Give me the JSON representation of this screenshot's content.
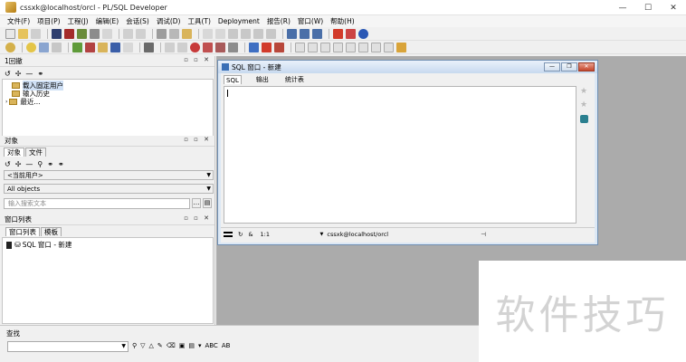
{
  "window": {
    "title": "cssxk@localhost/orcl - PL/SQL Developer",
    "controls": [
      "—",
      "☐",
      "✕"
    ]
  },
  "menu": [
    "文件(F)",
    "项目(P)",
    "工程(J)",
    "编辑(E)",
    "会话(S)",
    "调试(D)",
    "工具(T)",
    "Deployment",
    "报告(R)",
    "窗口(W)",
    "帮助(H)"
  ],
  "colors": {
    "accent": "#3a6fb6",
    "folder": "#d9b45a",
    "mdi_background": "#ababab",
    "stop_red": "#d23b2b",
    "info_blue": "#2a58b5"
  },
  "panels": {
    "history": {
      "title": "1回撤",
      "toolbar": [
        "↺",
        "✢",
        "—",
        "⚭"
      ],
      "items": [
        "载入固定用户",
        "输入历史",
        "最近..."
      ]
    },
    "objects": {
      "title": "对象",
      "tabs": [
        "对象",
        "文件"
      ],
      "toolbar": [
        "↺",
        "✢",
        "—",
        "⚲",
        "⚭",
        "⚭"
      ],
      "user_combo": "<当前用户>",
      "filter_combo": "All objects",
      "search_placeholder": "输入搜索文本"
    },
    "window_list": {
      "title": "窗口列表",
      "tabs": [
        "窗口列表",
        "模板"
      ],
      "items": [
        "SQL 窗口 - 新建"
      ]
    },
    "panel_controls": "▫ ▫ ✕"
  },
  "sql_window": {
    "title": "SQL 窗口 - 新建",
    "tabs": [
      "SQL",
      "输出",
      "统计表"
    ],
    "status": {
      "position": "1:1",
      "connection": "cssxk@localhost/orcl"
    }
  },
  "find": {
    "label": "查找",
    "tools": [
      "ABC",
      "AB"
    ]
  },
  "watermark": "软件技巧"
}
